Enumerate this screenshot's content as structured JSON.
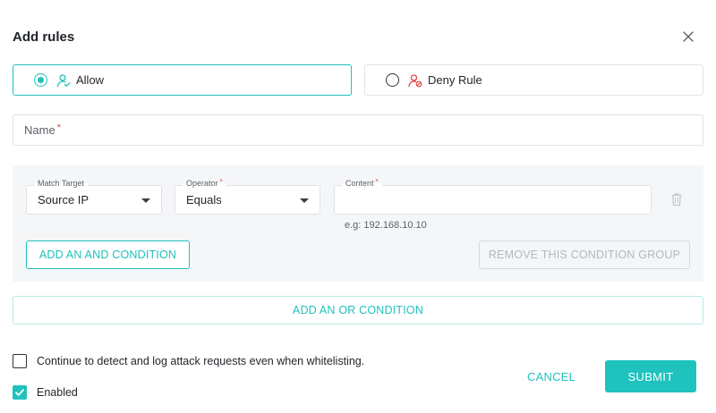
{
  "dialog": {
    "title": "Add rules"
  },
  "rule_type": {
    "selected": "allow",
    "options": [
      {
        "id": "allow",
        "label": "Allow",
        "icon": "user-check-icon"
      },
      {
        "id": "deny",
        "label": "Deny Rule",
        "icon": "user-block-icon"
      }
    ]
  },
  "name_field": {
    "label": "Name",
    "required_mark": "*",
    "value": ""
  },
  "condition_group": {
    "match_target": {
      "label": "Match Target",
      "value": "Source IP"
    },
    "operator": {
      "label": "Operator",
      "required_mark": "*",
      "value": "Equals"
    },
    "content": {
      "label": "Content",
      "required_mark": "*",
      "value": "",
      "hint": "e.g: 192.168.10.10"
    },
    "add_and_label": "ADD AN AND CONDITION",
    "remove_group_label": "REMOVE THIS CONDITION GROUP"
  },
  "add_or_label": "ADD AN OR CONDITION",
  "options": {
    "continue_detect": {
      "label": "Continue to detect and log attack requests even when whitelisting.",
      "checked": false
    },
    "enabled": {
      "label": "Enabled",
      "checked": true
    }
  },
  "footer": {
    "cancel_label": "CANCEL",
    "submit_label": "SUBMIT"
  },
  "colors": {
    "accent": "#1fc2bd",
    "danger": "#e54545",
    "panel_bg": "#f5f6f8"
  }
}
